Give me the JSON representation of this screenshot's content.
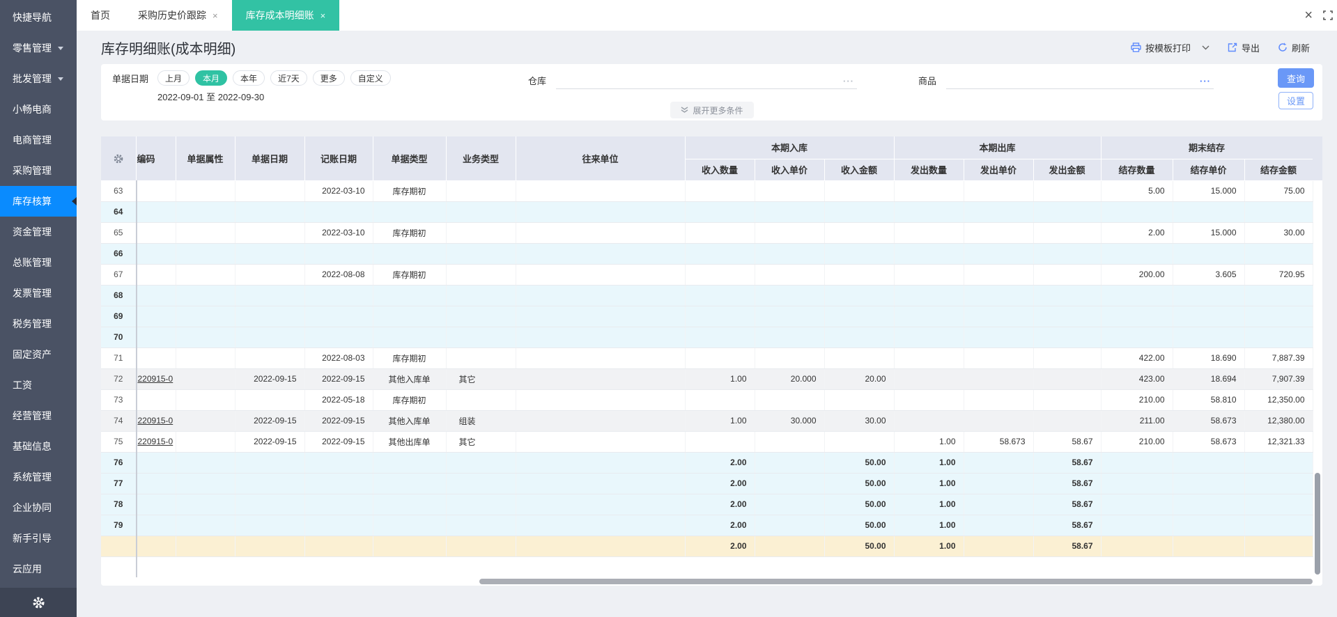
{
  "sidebar": {
    "items": [
      {
        "label": "快捷导航",
        "caret": false,
        "active": false
      },
      {
        "label": "零售管理",
        "caret": true,
        "active": false
      },
      {
        "label": "批发管理",
        "caret": true,
        "active": false
      },
      {
        "label": "小畅电商",
        "caret": false,
        "active": false
      },
      {
        "label": "电商管理",
        "caret": false,
        "active": false
      },
      {
        "label": "采购管理",
        "caret": false,
        "active": false
      },
      {
        "label": "库存核算",
        "caret": false,
        "active": true
      },
      {
        "label": "资金管理",
        "caret": false,
        "active": false
      },
      {
        "label": "总账管理",
        "caret": false,
        "active": false
      },
      {
        "label": "发票管理",
        "caret": false,
        "active": false
      },
      {
        "label": "税务管理",
        "caret": false,
        "active": false
      },
      {
        "label": "固定资产",
        "caret": false,
        "active": false
      },
      {
        "label": "工资",
        "caret": false,
        "active": false
      },
      {
        "label": "经营管理",
        "caret": false,
        "active": false
      },
      {
        "label": "基础信息",
        "caret": false,
        "active": false
      },
      {
        "label": "系统管理",
        "caret": false,
        "active": false
      },
      {
        "label": "企业协同",
        "caret": false,
        "active": false
      },
      {
        "label": "新手引导",
        "caret": false,
        "active": false
      },
      {
        "label": "云应用",
        "caret": false,
        "active": false
      }
    ]
  },
  "tabbar": {
    "close_glyph": "×",
    "tabs": [
      {
        "label": "首页",
        "closable": false,
        "active": false
      },
      {
        "label": "采购历史价跟踪",
        "closable": true,
        "active": false
      },
      {
        "label": "库存成本明细账",
        "closable": true,
        "active": true
      }
    ]
  },
  "window": {
    "close_label": "×"
  },
  "page": {
    "title": "库存明细账(成本明细)"
  },
  "toolbar": {
    "print_label": "按模板打印",
    "export_label": "导出",
    "refresh_label": "刷新"
  },
  "filters": {
    "date_label": "单据日期",
    "pills": [
      "上月",
      "本月",
      "本年",
      "近7天",
      "更多",
      "自定义"
    ],
    "selected_pill": "本月",
    "range": "2022-09-01 至 2022-09-30",
    "warehouse_label": "仓库",
    "product_label": "商品",
    "ellipsis": "···",
    "query_label": "查询",
    "settings_label": "设置",
    "expand_label": "展开更多条件"
  },
  "table": {
    "col_code": "编码",
    "col_attr": "单据属性",
    "col_docdate": "单据日期",
    "col_bookdate": "记账日期",
    "col_doctype": "单据类型",
    "col_biztype": "业务类型",
    "col_partner": "往来单位",
    "grp_in": "本期入库",
    "grp_out": "本期出库",
    "grp_bal": "期末结存",
    "col_in_qty": "收入数量",
    "col_in_price": "收入单价",
    "col_in_amt": "收入金额",
    "col_out_qty": "发出数量",
    "col_out_price": "发出单价",
    "col_out_amt": "发出金额",
    "col_bal_qty": "结存数量",
    "col_bal_price": "结存单价",
    "col_bal_amt": "结存金额",
    "rows": [
      {
        "n": "63",
        "bg": "w",
        "code": "",
        "attr": "",
        "d1": "",
        "d2": "2022-03-10",
        "type": "库存期初",
        "biz": "",
        "partner": "",
        "iq": "",
        "ip": "",
        "ia": "",
        "oq": "",
        "op": "",
        "oa": "",
        "bq": "5.00",
        "bp": "15.000",
        "ba": "75.00"
      },
      {
        "n": "64",
        "bg": "c",
        "code": "",
        "attr": "",
        "d1": "",
        "d2": "",
        "type": "",
        "biz": "",
        "partner": "",
        "iq": "",
        "ip": "",
        "ia": "",
        "oq": "",
        "op": "",
        "oa": "",
        "bq": "",
        "bp": "",
        "ba": ""
      },
      {
        "n": "65",
        "bg": "w",
        "code": "",
        "attr": "",
        "d1": "",
        "d2": "2022-03-10",
        "type": "库存期初",
        "biz": "",
        "partner": "",
        "iq": "",
        "ip": "",
        "ia": "",
        "oq": "",
        "op": "",
        "oa": "",
        "bq": "2.00",
        "bp": "15.000",
        "ba": "30.00"
      },
      {
        "n": "66",
        "bg": "c",
        "code": "",
        "attr": "",
        "d1": "",
        "d2": "",
        "type": "",
        "biz": "",
        "partner": "",
        "iq": "",
        "ip": "",
        "ia": "",
        "oq": "",
        "op": "",
        "oa": "",
        "bq": "",
        "bp": "",
        "ba": ""
      },
      {
        "n": "67",
        "bg": "w",
        "code": "",
        "attr": "",
        "d1": "",
        "d2": "2022-08-08",
        "type": "库存期初",
        "biz": "",
        "partner": "",
        "iq": "",
        "ip": "",
        "ia": "",
        "oq": "",
        "op": "",
        "oa": "",
        "bq": "200.00",
        "bp": "3.605",
        "ba": "720.95"
      },
      {
        "n": "68",
        "bg": "c",
        "code": "",
        "attr": "",
        "d1": "",
        "d2": "",
        "type": "",
        "biz": "",
        "partner": "",
        "iq": "",
        "ip": "",
        "ia": "",
        "oq": "",
        "op": "",
        "oa": "",
        "bq": "",
        "bp": "",
        "ba": ""
      },
      {
        "n": "69",
        "bg": "c",
        "code": "",
        "attr": "",
        "d1": "",
        "d2": "",
        "type": "",
        "biz": "",
        "partner": "",
        "iq": "",
        "ip": "",
        "ia": "",
        "oq": "",
        "op": "",
        "oa": "",
        "bq": "",
        "bp": "",
        "ba": ""
      },
      {
        "n": "70",
        "bg": "c",
        "code": "",
        "attr": "",
        "d1": "",
        "d2": "",
        "type": "",
        "biz": "",
        "partner": "",
        "iq": "",
        "ip": "",
        "ia": "",
        "oq": "",
        "op": "",
        "oa": "",
        "bq": "",
        "bp": "",
        "ba": ""
      },
      {
        "n": "71",
        "bg": "w",
        "code": "",
        "attr": "",
        "d1": "",
        "d2": "2022-08-03",
        "type": "库存期初",
        "biz": "",
        "partner": "",
        "iq": "",
        "ip": "",
        "ia": "",
        "oq": "",
        "op": "",
        "oa": "",
        "bq": "422.00",
        "bp": "18.690",
        "ba": "7,887.39"
      },
      {
        "n": "72",
        "bg": "g",
        "code": "220915-0",
        "attr": "",
        "d1": "2022-09-15",
        "d2": "2022-09-15",
        "type": "其他入库单",
        "biz": "其它",
        "partner": "",
        "iq": "1.00",
        "ip": "20.000",
        "ia": "20.00",
        "oq": "",
        "op": "",
        "oa": "",
        "bq": "423.00",
        "bp": "18.694",
        "ba": "7,907.39"
      },
      {
        "n": "73",
        "bg": "w",
        "code": "",
        "attr": "",
        "d1": "",
        "d2": "2022-05-18",
        "type": "库存期初",
        "biz": "",
        "partner": "",
        "iq": "",
        "ip": "",
        "ia": "",
        "oq": "",
        "op": "",
        "oa": "",
        "bq": "210.00",
        "bp": "58.810",
        "ba": "12,350.00"
      },
      {
        "n": "74",
        "bg": "g",
        "code": "220915-0",
        "attr": "",
        "d1": "2022-09-15",
        "d2": "2022-09-15",
        "type": "其他入库单",
        "biz": "组装",
        "partner": "",
        "iq": "1.00",
        "ip": "30.000",
        "ia": "30.00",
        "oq": "",
        "op": "",
        "oa": "",
        "bq": "211.00",
        "bp": "58.673",
        "ba": "12,380.00"
      },
      {
        "n": "75",
        "bg": "w",
        "code": "220915-0",
        "attr": "",
        "d1": "2022-09-15",
        "d2": "2022-09-15",
        "type": "其他出库单",
        "biz": "其它",
        "partner": "",
        "iq": "",
        "ip": "",
        "ia": "",
        "oq": "1.00",
        "op": "58.673",
        "oa": "58.67",
        "bq": "210.00",
        "bp": "58.673",
        "ba": "12,321.33"
      },
      {
        "n": "76",
        "bg": "c",
        "code": "",
        "attr": "",
        "d1": "",
        "d2": "",
        "type": "",
        "biz": "",
        "partner": "",
        "iq": "2.00",
        "ip": "",
        "ia": "50.00",
        "oq": "1.00",
        "op": "",
        "oa": "58.67",
        "bq": "",
        "bp": "",
        "ba": ""
      },
      {
        "n": "77",
        "bg": "c",
        "code": "",
        "attr": "",
        "d1": "",
        "d2": "",
        "type": "",
        "biz": "",
        "partner": "",
        "iq": "2.00",
        "ip": "",
        "ia": "50.00",
        "oq": "1.00",
        "op": "",
        "oa": "58.67",
        "bq": "",
        "bp": "",
        "ba": ""
      },
      {
        "n": "78",
        "bg": "c",
        "code": "",
        "attr": "",
        "d1": "",
        "d2": "",
        "type": "",
        "biz": "",
        "partner": "",
        "iq": "2.00",
        "ip": "",
        "ia": "50.00",
        "oq": "1.00",
        "op": "",
        "oa": "58.67",
        "bq": "",
        "bp": "",
        "ba": ""
      },
      {
        "n": "79",
        "bg": "c",
        "code": "",
        "attr": "",
        "d1": "",
        "d2": "",
        "type": "",
        "biz": "",
        "partner": "",
        "iq": "2.00",
        "ip": "",
        "ia": "50.00",
        "oq": "1.00",
        "op": "",
        "oa": "58.67",
        "bq": "",
        "bp": "",
        "ba": ""
      },
      {
        "n": "",
        "bg": "y",
        "code": "",
        "attr": "",
        "d1": "",
        "d2": "",
        "type": "",
        "biz": "",
        "partner": "",
        "iq": "2.00",
        "ip": "",
        "ia": "50.00",
        "oq": "1.00",
        "op": "",
        "oa": "58.67",
        "bq": "",
        "bp": "",
        "ba": ""
      }
    ]
  },
  "colors": {
    "accent_blue": "#6a98f7",
    "active_nav_blue": "#0a8bfe",
    "tab_teal": "#32c2a4",
    "subtotal_row": "#e9f7fc",
    "stripe_row": "#f1f2f4",
    "highlight_row": "#fbf0d3",
    "header_bg": "#e3e6f0",
    "sidebar_bg": "#4a5264"
  }
}
